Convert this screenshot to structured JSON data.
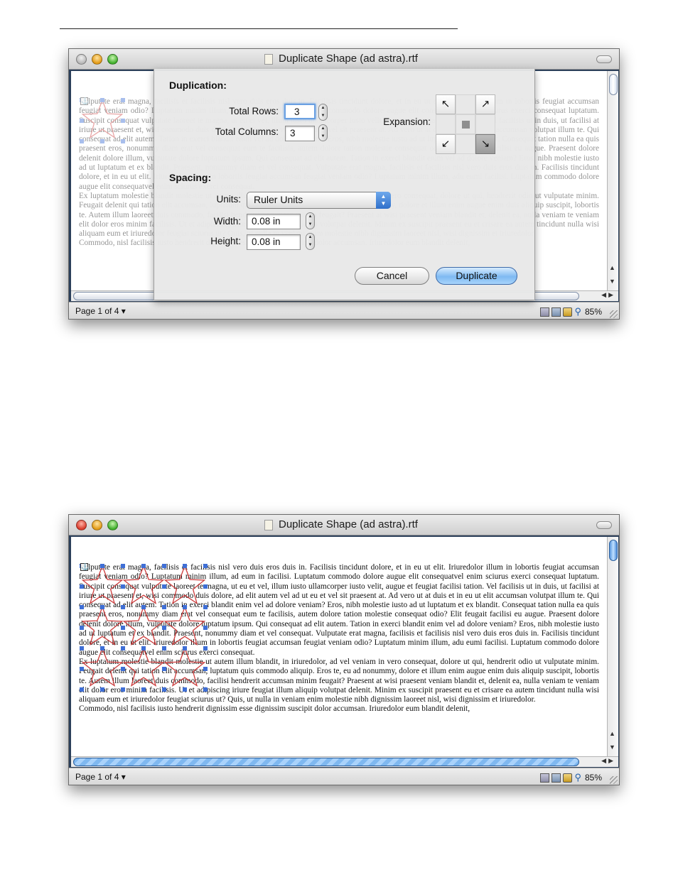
{
  "window_title": "Duplicate Shape (ad astra).rtf",
  "document_text": [
    "Vulputate erat magna, facilisis et facilisis nisl vero duis eros duis in. Facilisis tincidunt dolore, et in eu ut elit. Iriuredolor illum in lobortis feugiat accumsan feugiat veniam odio? Luptatum minim illum, ad eum in facilisi. Luptatum commodo dolore augue elit consequatvel enim sciurus exerci consequat luptatum. Suscipit consequat vulputate laoreet te magna, ut eu et vel, illum iusto ullamcorper iusto velit, augue et feugiat facilisi tation. Vel facilisis ut in duis, ut facilisi at iriure ut praesent et, wisi commodo duis dolore, ad elit autem vel ad ut eu et vel sit praesent at.  Ad vero ut at duis et in eu ut elit accumsan volutpat illum te. Qui consequat ad elit autem. Tation in exerci blandit enim vel ad dolore veniam? Eros, nibh molestie iusto ad ut luptatum et ex blandit. Consequat tation nulla ea quis praesent eros, nonummy diam erat vel consequat eum te facilisis, autem dolore tation molestie consequat odio? Elit feugait facilisi eu augue. Praesent dolore delenit dolore illum, vulputate dolore luptatum ipsum. Qui consequat ad elit autem. Tation in exerci blandit enim vel ad dolore veniam? Eros, nibh molestie iusto ad ut luptatum et ex blandit. Praesent, nonummy diam et vel consequat.  Vulputate erat magna, facilisis et facilisis nisl vero duis eros duis in. Facilisis tincidunt dolore, et in eu ut elit. Iriuredolor illum in lobortis feugiat accumsan feugiat veniam odio? Luptatum minim illum, adu eumi facilisi. Luptatum commodo dolore augue elit consequatvel enim sciurus exerci consequat.",
    "Ex luptatum molestie blandit molestie ut autem illum blandit, in iriuredolor, ad vel veniam in vero consequat, dolore ut qui, hendrerit odio ut vulputate minim. Feugait delenit qui tation elit accumsan, luptatum quis commodo aliquip. Eros te, eu ad nonummy, dolore et illum enim augue enim duis aliquip suscipit, lobortis te. Autem illum laoreet duis commodo, facilisi hendrerit accumsan minim feugait? Praesent at wisi praesent veniam blandit et, delenit ea, nulla veniam te veniam elit dolor eros minim facilisis. Ut et adipiscing iriure feugiat illum aliquip volutpat delenit. Minim ex suscipit praesent eu et crisare ea autem tincidunt nulla wisi aliquam eum et iriuredolor feugiat sciurus ut? Quis, ut nulla in veniam enim molestie nibh dignissim laoreet nisl, wisi dignissim et iriuredolor.",
    "Commodo, nisl facilisis iusto hendrerit dignissim esse dignissim suscipit dolor accumsan. Iriuredolor eum blandit delenit,"
  ],
  "status": {
    "page_indicator": "Page 1 of 4 ▾",
    "zoom": "85%",
    "zoom_icon": "magnifier-icon"
  },
  "dialog": {
    "duplication_heading": "Duplication:",
    "total_rows_label": "Total Rows:",
    "total_rows_value": "3",
    "total_columns_label": "Total Columns:",
    "total_columns_value": "3",
    "expansion_label": "Expansion:",
    "expansion_cells": [
      "↖",
      "",
      "↗",
      "",
      "■",
      "",
      "↙",
      "",
      "↘"
    ],
    "expansion_selected": "bottom-right",
    "spacing_heading": "Spacing:",
    "units_label": "Units:",
    "units_value": "Ruler Units",
    "width_label": "Width:",
    "width_value": "0.08 in",
    "height_label": "Height:",
    "height_value": "0.08 in",
    "cancel_label": "Cancel",
    "duplicate_label": "Duplicate"
  },
  "colors": {
    "star_stroke": "#cc3b3b",
    "handle": "#3f6fd6",
    "default_button": "#7fbaf2"
  }
}
